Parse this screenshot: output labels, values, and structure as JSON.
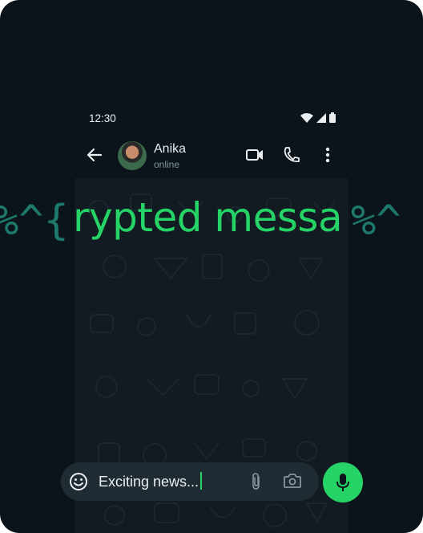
{
  "status_bar": {
    "time": "12:30"
  },
  "chat": {
    "contact_name": "Anika",
    "contact_status": "online"
  },
  "overlay": {
    "left_fragment": "%^{",
    "right_fragment": "%^",
    "headline": "rypted messa"
  },
  "composer": {
    "draft_text": "Exciting news..."
  },
  "colors": {
    "background": "#0b141a",
    "accent": "#25d366",
    "composer_bg": "#1f2c34"
  },
  "icons": [
    "back-arrow-icon",
    "video-call-icon",
    "voice-call-icon",
    "more-options-icon",
    "emoji-icon",
    "attach-icon",
    "camera-icon",
    "mic-icon",
    "wifi-icon",
    "signal-icon",
    "battery-icon"
  ]
}
